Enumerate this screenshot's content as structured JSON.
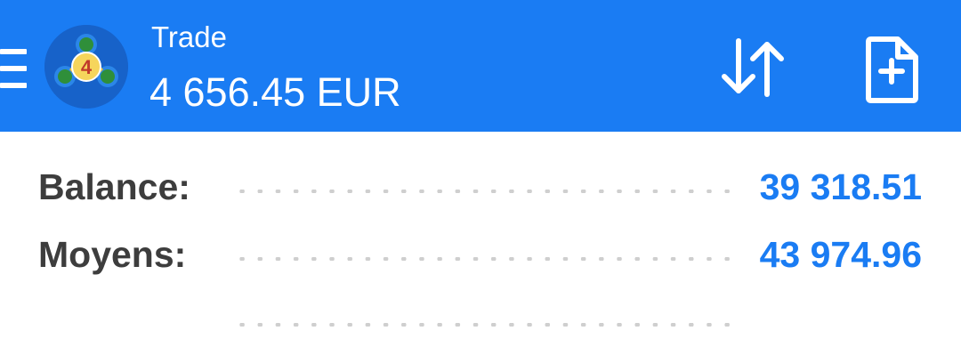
{
  "header": {
    "title": "Trade",
    "subtitle": "4 656.45 EUR",
    "menu_icon": "hamburger-menu-icon",
    "logo_icon": "metatrader-4-logo",
    "actions": [
      {
        "icon": "sort-arrows-icon"
      },
      {
        "icon": "new-order-document-plus-icon"
      }
    ],
    "colors": {
      "bar": "#1a7cf3",
      "text": "#ffffff"
    }
  },
  "summary": {
    "rows": [
      {
        "label": "Balance:",
        "value": "39 318.51"
      },
      {
        "label": "Moyens:",
        "value": "43 974.96"
      },
      {
        "label": "",
        "value": ""
      }
    ],
    "colors": {
      "label": "#3d3d3d",
      "value": "#1a7cf3",
      "dots": "#cfcfcf"
    }
  }
}
